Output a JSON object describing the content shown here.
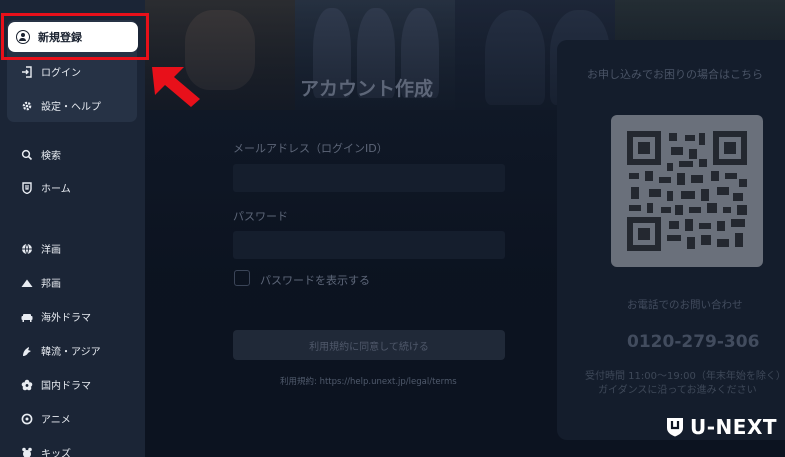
{
  "sidebar": {
    "signup_label": "新規登録",
    "login_label": "ログイン",
    "settings_label": "設定・ヘルプ",
    "items": [
      {
        "label": "検索",
        "icon": "search-icon"
      },
      {
        "label": "ホーム",
        "icon": "home-icon"
      },
      {
        "label": "洋画",
        "icon": "globe-icon"
      },
      {
        "label": "邦画",
        "icon": "mountain-icon"
      },
      {
        "label": "海外ドラマ",
        "icon": "sofa-icon"
      },
      {
        "label": "韓流・アジア",
        "icon": "dragon-icon"
      },
      {
        "label": "国内ドラマ",
        "icon": "flower-icon"
      },
      {
        "label": "アニメ",
        "icon": "anime-icon"
      },
      {
        "label": "キッズ",
        "icon": "kids-icon"
      }
    ]
  },
  "form": {
    "title": "アカウント作成",
    "email_label": "メールアドレス（ログインID）",
    "password_label": "パスワード",
    "show_password_label": "パスワードを表示する",
    "submit_label": "利用規約に同意して続ける",
    "terms_text": "利用規約: https://help.unext.jp/legal/terms"
  },
  "help": {
    "title": "お申し込みでお困りの場合はこちら",
    "phone_label": "お電話でのお問い合わせ",
    "phone": "0120-279-306",
    "hours_line1": "受付時間 11:00～19:00（年末年始を除く）",
    "hours_line2": "ガイダンスに沿ってお進みください"
  },
  "brand": {
    "logo_text": "U-NEXT"
  },
  "colors": {
    "highlight": "#e8101a",
    "sidebar_bg": "#1b2536",
    "page_bg": "#0d1422"
  }
}
